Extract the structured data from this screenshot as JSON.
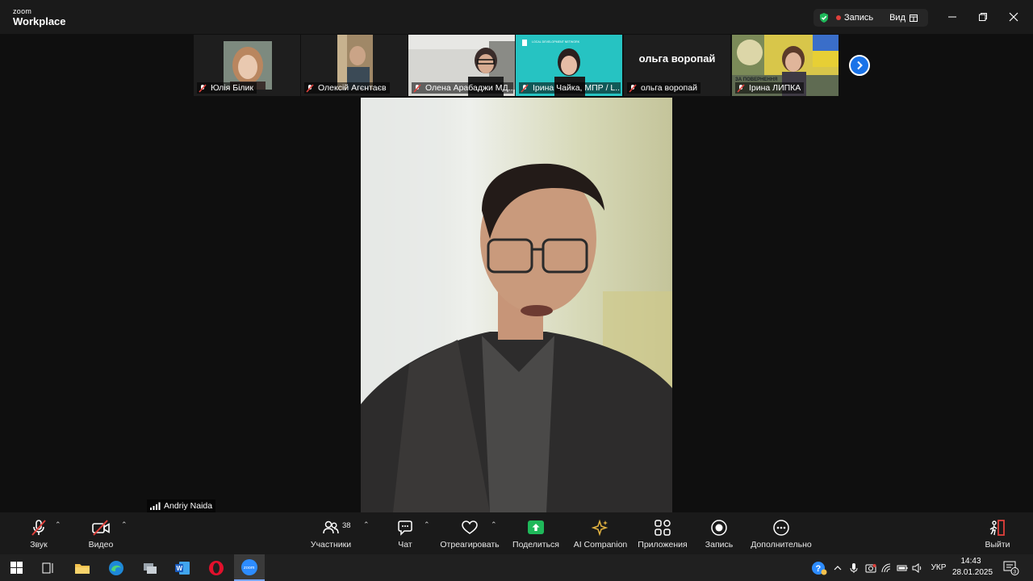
{
  "window": {
    "brand_small": "zoom",
    "brand_big": "Workplace",
    "recording_label": "Запись",
    "view_label": "Вид"
  },
  "gallery": {
    "tiles": [
      {
        "name": "Юлія Білик"
      },
      {
        "name": "Олексій Агєнтаєв"
      },
      {
        "name": "Олена Арабаджи МД..."
      },
      {
        "name": "Ірина Чайка, МПР / L..."
      },
      {
        "name": "ольга воропай",
        "display_text": "ольга воропай"
      },
      {
        "name": "Ірина ЛИПКА"
      }
    ],
    "tile4_logo_text": "LOCAL DEVELOPMENT NETWORK",
    "tile6_banner_text": "ЗА ПОВЕРНЕННЯ"
  },
  "speaker": {
    "name": "Andriy Naida"
  },
  "toolbar": {
    "audio_label": "Звук",
    "video_label": "Видео",
    "participants_label": "Участники",
    "participants_count": "38",
    "chat_label": "Чат",
    "react_label": "Отреагировать",
    "share_label": "Поделиться",
    "ai_label": "AI Companion",
    "apps_label": "Приложения",
    "record_label": "Запись",
    "more_label": "Дополнительно",
    "leave_label": "Выйти"
  },
  "taskbar": {
    "language": "УКР",
    "time": "14:43",
    "date": "28.01.2025",
    "notification_count": "3"
  },
  "colors": {
    "accent_blue": "#1a73e8",
    "share_green": "#1fb85a",
    "muted_red": "#e0403b",
    "record_red": "#e0403b"
  }
}
